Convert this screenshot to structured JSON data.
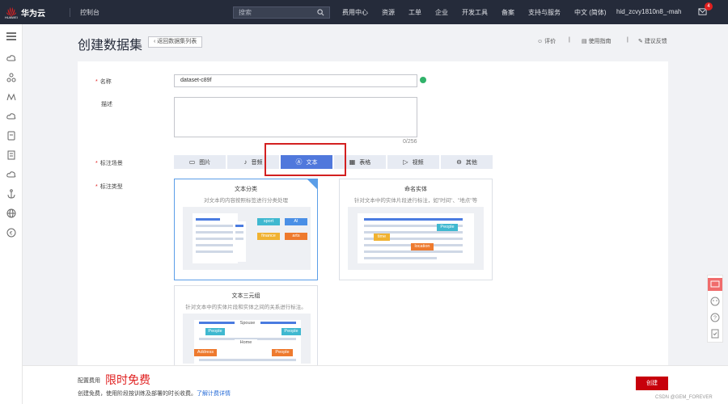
{
  "topbar": {
    "brand": "华为云",
    "brand_sub": "HUAWEI",
    "console": "控制台",
    "search_placeholder": "搜索",
    "nav": [
      "费用中心",
      "资源",
      "工单",
      "企业",
      "开发工具",
      "备案",
      "支持与服务",
      "中文 (简体)"
    ],
    "user": "hid_zcvy1810n8_-mah",
    "mail_badge": "4"
  },
  "page": {
    "title": "创建数据集",
    "back_label": "返回数据集列表",
    "links": [
      "评价",
      "使用指南",
      "建议反馈"
    ]
  },
  "form": {
    "name_label": "名称",
    "name_value": "dataset-c89f",
    "desc_label": "描述",
    "desc_counter": "0/256",
    "scene_label": "标注场景",
    "scenes": [
      {
        "label": "图片",
        "icon": "image-icon"
      },
      {
        "label": "音频",
        "icon": "microphone-icon"
      },
      {
        "label": "文本",
        "icon": "text-icon",
        "selected": true
      },
      {
        "label": "表格",
        "icon": "table-icon"
      },
      {
        "label": "视频",
        "icon": "video-icon"
      },
      {
        "label": "其他",
        "icon": "more-icon"
      }
    ],
    "type_label": "标注类型",
    "types": [
      {
        "title": "文本分类",
        "desc": "对文本的内容按照标签进行分类处理",
        "selected": true,
        "tags": [
          "sport",
          "AI",
          "finance",
          "arts"
        ]
      },
      {
        "title": "命名实体",
        "desc": "针对文本中的实体片段进行标注，如\"时间\"、\"地点\"等",
        "tags": [
          "People",
          "time",
          "location"
        ]
      },
      {
        "title": "文本三元组",
        "desc": "针对文本中的实体片段和实体之间的关系进行标注。",
        "tags": [
          "Spouse",
          "People",
          "People",
          "Home",
          "Address",
          "People"
        ]
      }
    ]
  },
  "footer": {
    "fee_label": "配置费用",
    "fee_value": "限时免费",
    "note": "创建免费，使用阶段按训练及部署的时长收费。",
    "note_link": "了解计费详情",
    "create_label": "创建",
    "watermark": "CSDN @GEM_FOREVER"
  },
  "colors": {
    "topbar": "#252b3a",
    "accent": "#5078dc",
    "primary_button": "#c7000b",
    "highlight_box": "#d32020"
  }
}
